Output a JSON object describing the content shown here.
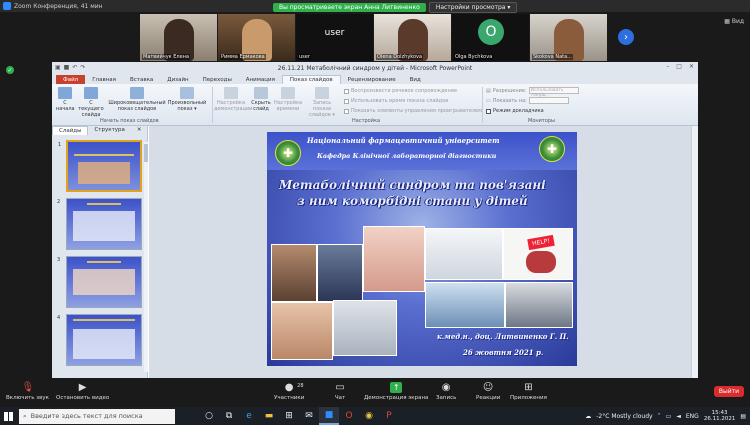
{
  "zoom": {
    "window_title": "Zoom Конференция, 41 мин",
    "banner_message": "Вы просматриваете экран Анна Литвиненко",
    "view_options_label": "Настройки просмотра ▾",
    "view_button": "Вид",
    "participants_tiles": [
      {
        "name": "Матвийчук Елена"
      },
      {
        "name": "Римма Ермакова"
      },
      {
        "name": "user",
        "label": "user"
      },
      {
        "name": "Olena Dolzhykova"
      },
      {
        "name": "Olga Bychkova",
        "letter": "O"
      },
      {
        "name": "Skokova Nata..."
      }
    ],
    "toolbar": {
      "mute_label": "Включить звук",
      "video_label": "Остановить видео",
      "participants_label": "Участники",
      "participants_count": "28",
      "chat_label": "Чат",
      "share_label": "Демонстрация экрана",
      "record_label": "Запись",
      "reactions_label": "Реакции",
      "apps_label": "Приложения",
      "leave_label": "Выйти"
    }
  },
  "ppt": {
    "title": "26.11.21 Метаболічний синдром у дітей - Microsoft PowerPoint",
    "tabs": [
      "Файл",
      "Главная",
      "Вставка",
      "Дизайн",
      "Переходы",
      "Анимация",
      "Показ слайдов",
      "Рецензирование",
      "Вид"
    ],
    "active_tab": "Показ слайдов",
    "ribbon": {
      "from_start": "С начала",
      "from_current": "С текущего слайда",
      "broadcast": "Широковещательный показ слайдов",
      "custom_show": "Произвольный показ ▾",
      "group_start": "Начать показ слайдов",
      "setup_show": "Настройка демонстрации",
      "hide_slide": "Скрыть слайд",
      "rehearse": "Настройка времени",
      "record_show": "Запись показа слайдов ▾",
      "chk_narration": "Воспроизвести речевое сопровождение",
      "chk_timings": "Использовать время показа слайдов",
      "chk_controls": "Показать элементы управления проигрывателем",
      "group_setup": "Настройка",
      "resolution_label": "Разрешение:",
      "resolution_value": "Использовать текущ...",
      "show_on_label": "Показать на:",
      "presenter_view": "Режим докладчика",
      "group_monitors": "Мониторы"
    },
    "pane_tabs": [
      "Слайды",
      "Структура"
    ],
    "slide_numbers": [
      "1",
      "2",
      "3",
      "4"
    ],
    "slide": {
      "university": "Національний фармацевтичний університет",
      "department": "Кафедра Клінічної лабораторної діагностики",
      "title_line1": "Метаболічний синдром та пов'язані",
      "title_line2": "з ним коморбідні стани у дітей",
      "author": "к.мед.н., доц. Литвиненко Г. П.",
      "date": "26 жовтня 2021 р.",
      "help_sign": "HELP!"
    }
  },
  "taskbar": {
    "search_placeholder": "Введите здесь текст для поиска",
    "weather": "-2°C  Mostly cloudy",
    "lang": "ENG",
    "time": "15:43",
    "date": "26.11.2021"
  }
}
